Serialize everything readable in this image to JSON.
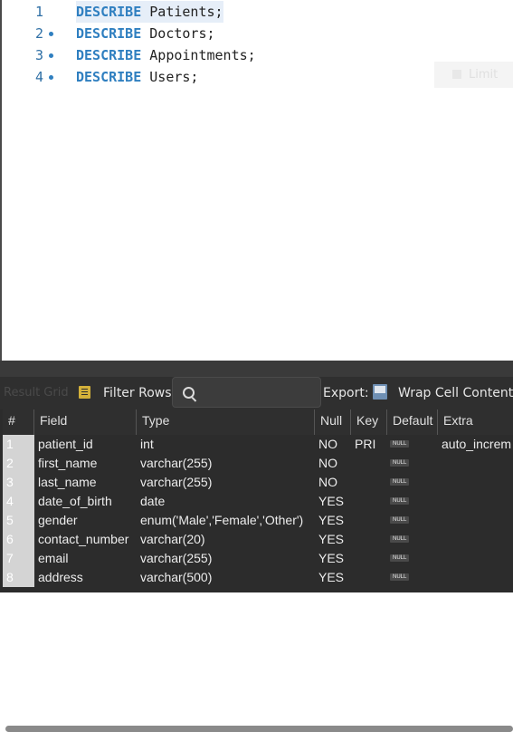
{
  "editor": {
    "lines": [
      {
        "num": "1",
        "keyword": "DESCRIBE",
        "rest": " Patients;"
      },
      {
        "num": "2",
        "keyword": "DESCRIBE",
        "rest": " Doctors;"
      },
      {
        "num": "3",
        "keyword": "DESCRIBE",
        "rest": " Appointments;"
      },
      {
        "num": "4",
        "keyword": "DESCRIBE",
        "rest": " Users;"
      }
    ],
    "ghost_button_label": "Limit"
  },
  "toolbar": {
    "result_tab": "Result Grid",
    "filter_label": "Filter Rows:",
    "export_label": "Export:",
    "wrap_label": "Wrap Cell Content:"
  },
  "grid": {
    "columns": [
      "#",
      "Field",
      "Type",
      "Null",
      "Key",
      "Default",
      "Extra"
    ],
    "rows": [
      {
        "n": "1",
        "field": "patient_id",
        "type": "int",
        "null": "NO",
        "key": "PRI",
        "default": "NULL",
        "extra": "auto_increm"
      },
      {
        "n": "2",
        "field": "first_name",
        "type": "varchar(255)",
        "null": "NO",
        "key": "",
        "default": "NULL",
        "extra": ""
      },
      {
        "n": "3",
        "field": "last_name",
        "type": "varchar(255)",
        "null": "NO",
        "key": "",
        "default": "NULL",
        "extra": ""
      },
      {
        "n": "4",
        "field": "date_of_birth",
        "type": "date",
        "null": "YES",
        "key": "",
        "default": "NULL",
        "extra": ""
      },
      {
        "n": "5",
        "field": "gender",
        "type": "enum('Male','Female','Other')",
        "null": "YES",
        "key": "",
        "default": "NULL",
        "extra": ""
      },
      {
        "n": "6",
        "field": "contact_number",
        "type": "varchar(20)",
        "null": "YES",
        "key": "",
        "default": "NULL",
        "extra": ""
      },
      {
        "n": "7",
        "field": "email",
        "type": "varchar(255)",
        "null": "YES",
        "key": "",
        "default": "NULL",
        "extra": ""
      },
      {
        "n": "8",
        "field": "address",
        "type": "varchar(500)",
        "null": "YES",
        "key": "",
        "default": "NULL",
        "extra": ""
      }
    ]
  }
}
